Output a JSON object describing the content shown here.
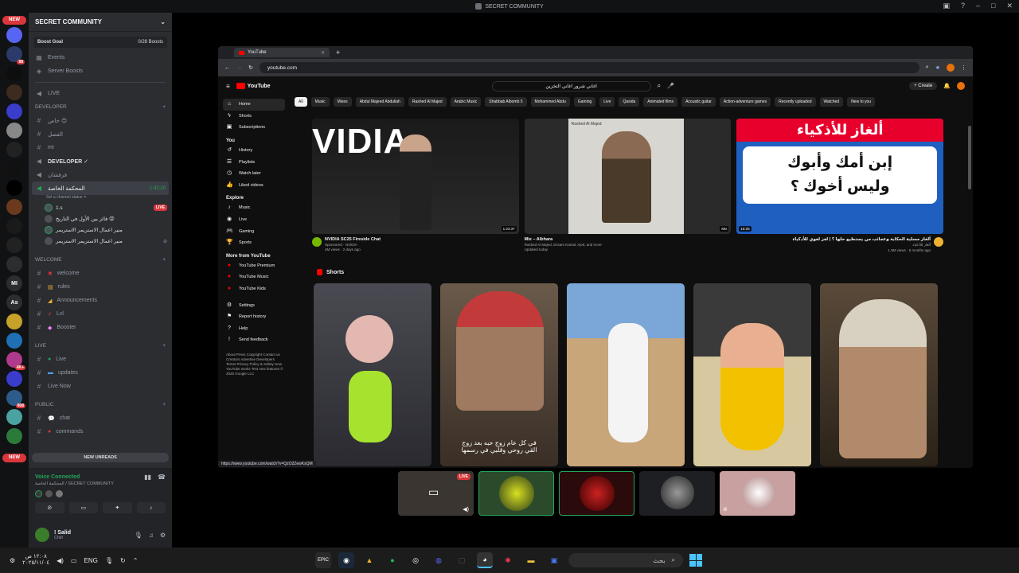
{
  "window": {
    "title": "SECRET COMMUNITY"
  },
  "servers": {
    "new_top": "NEW",
    "new_bottom": "NEW",
    "badges": [
      "98",
      "4K+",
      "908"
    ],
    "labels": [
      "As",
      "MI"
    ]
  },
  "server": {
    "name": "SECRET COMMUNITY",
    "boost_goal": "Boost Goal",
    "boost_count": "0/28 Boosts"
  },
  "channels": {
    "top": [
      {
        "icon": "calendar-icon",
        "label": "Events"
      },
      {
        "icon": "boost-icon",
        "label": "Server Boosts"
      }
    ],
    "live_label": "LIVE",
    "cat_developer": "DEVELOPER",
    "dev_items": [
      "خاص 😊",
      "الفصل",
      "mt"
    ],
    "developer_voice": "DEVELOPER ✓",
    "voice_items": [
      "فرفشان"
    ],
    "active_voice": "المحكمة الخاصة",
    "active_time": "1:42:20",
    "set_status": "Set a channel status ✏",
    "voice_users": [
      {
        "name": "1.s",
        "live": "LIVE"
      },
      {
        "name": "فائز بين الأول في التاريخ 😡"
      },
      {
        "name": "منير اعمال الاستريمر الاستريمر"
      },
      {
        "name": "منير اعمال الاستريمر الاستريمر"
      }
    ],
    "cat_welcome": "welcome",
    "welcome_items": [
      "welcome",
      "rules",
      "Announcements",
      "Lvl",
      "Booster"
    ],
    "cat_live": "LIVE",
    "live_items": [
      "Live",
      "updates",
      "Live Now"
    ],
    "cat_public": "PUBLIC",
    "public_items": [
      "chat",
      "commands"
    ],
    "new_unreads": "NEW UNREADS"
  },
  "voice_panel": {
    "status": "Voice Connected",
    "location": "المحكمة الخاصة / SECRET COMMUNITY"
  },
  "user_panel": {
    "name": "! Salid",
    "status": "Chill"
  },
  "browser": {
    "tab_title": "YouTube",
    "url": "youtube.com",
    "status_url": "https://www.youtube.com/watch?v=QzO2ZewKsQM"
  },
  "youtube": {
    "logo_text": "YouTube",
    "search_value": "اغاني شرور اغاني التخزين",
    "create_label": "Create",
    "sidebar": {
      "main": [
        "Home",
        "Shorts",
        "Subscriptions"
      ],
      "you_head": "You",
      "you": [
        "History",
        "Playlists",
        "Watch later",
        "Liked videos"
      ],
      "explore_head": "Explore",
      "explore": [
        "Music",
        "Live",
        "Gaming",
        "Sports"
      ],
      "more_head": "More from YouTube",
      "more": [
        "YouTube Premium",
        "YouTube Music",
        "YouTube Kids"
      ],
      "settings": [
        "Settings",
        "Report history",
        "Help",
        "Send feedback"
      ],
      "footer": "About Press Copyright Contact us Creators Advertise Developers Terms Privacy Policy & Safety How YouTube works Test new features © 2025 Google LLC"
    },
    "chips": [
      "All",
      "Music",
      "Mixes",
      "Abdul Majeed Abdullah",
      "Rashed Al Majed",
      "Arabic Music",
      "Shabbab Albomb 5",
      "Mohammed Abdu",
      "Gaming",
      "Live",
      "Qasida",
      "Animated films",
      "Acoustic guitar",
      "Action-adventure games",
      "Recently uploaded",
      "Watched",
      "New to you"
    ],
    "videos": [
      {
        "title": "NVIDIA SC25 Fireside Chat",
        "channel": "Sponsored · NVIDIA",
        "meta": "4M views · 2 days ago",
        "duration": "1:23:37",
        "thumb_text": "VIDIA"
      },
      {
        "title": "Mix – Albhara",
        "channel": "Rashed Al Majed, Essam Kamal, Ajed, and more",
        "meta": "Updated today",
        "duration": "Mix",
        "thumb_text": "Rashed Al Majed"
      },
      {
        "title": "ألغاز مسلية الحكاية وعجائب من يستطيع حلها ؟ | لغز لغوي للأذكياء",
        "channel": "ألغاز للأذكياء",
        "meta": "1.3M views · 5 months ago",
        "duration": "16:25",
        "thumb_line1": "ألغاز للأذكياء",
        "thumb_line2": "إبن أمك وأبوك",
        "thumb_line3": "وليس أخوك ؟"
      }
    ],
    "shorts_head": "Shorts",
    "short_caption": "في كل عام زوج حبه بعد زوج\nالقي روحي وقلبي في رسمها"
  },
  "stream_tiles": [
    {
      "live": "LIVE"
    },
    {},
    {},
    {},
    {}
  ],
  "taskbar": {
    "time": "١٢:٠٨ ص",
    "date": "٢٠٢٥/١١/٠٤",
    "lang": "ENG",
    "search_placeholder": "بحث"
  }
}
